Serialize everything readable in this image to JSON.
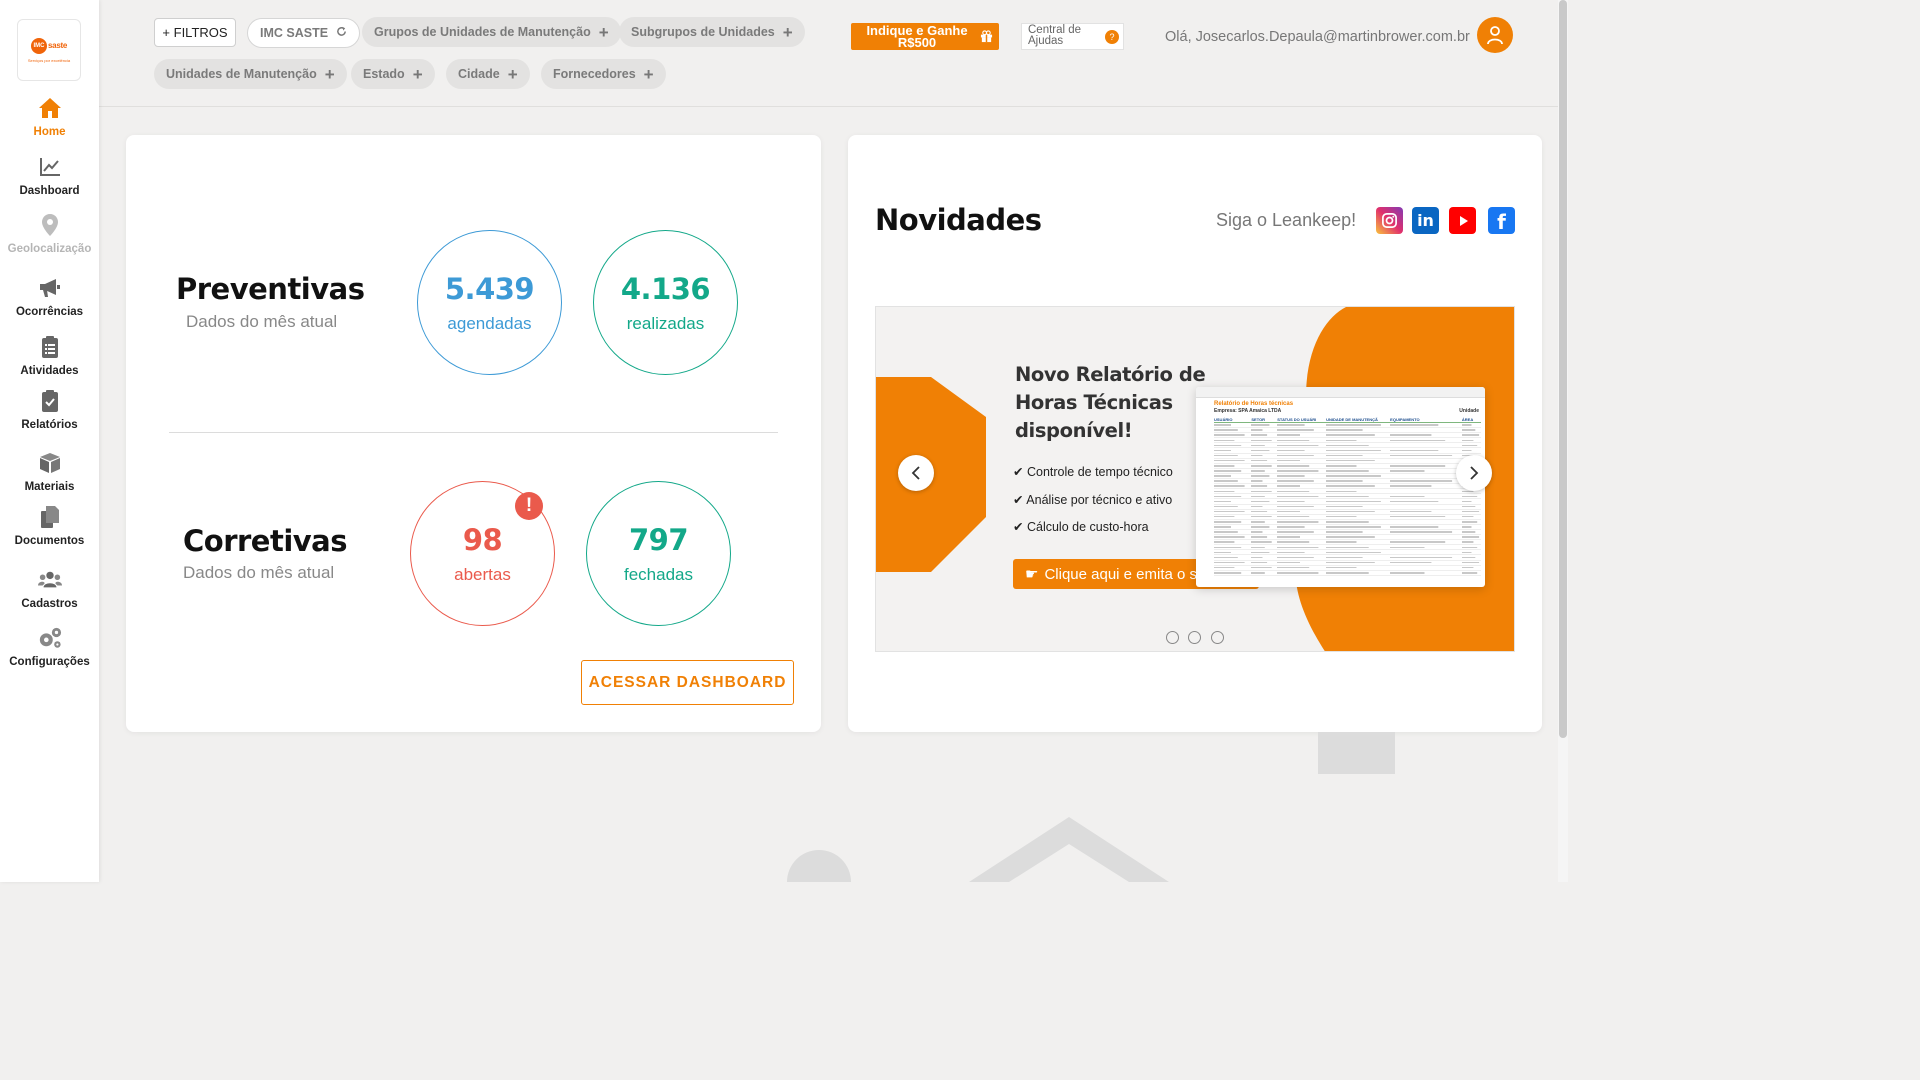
{
  "sidebar": {
    "logo": {
      "mark": "IMC",
      "word": "saste",
      "tagline": "Serviços por excelência"
    },
    "items": [
      {
        "label": "Home"
      },
      {
        "label": "Dashboard"
      },
      {
        "label": "Geolocalização"
      },
      {
        "label": "Ocorrências"
      },
      {
        "label": "Atividades"
      },
      {
        "label": "Relatórios"
      },
      {
        "label": "Materiais"
      },
      {
        "label": "Documentos"
      },
      {
        "label": "Cadastros"
      },
      {
        "label": "Configurações"
      }
    ]
  },
  "filters": {
    "button": "+ FILTROS",
    "chips": [
      {
        "label": "IMC SASTE"
      },
      {
        "label": "Grupos de Unidades de Manutenção"
      },
      {
        "label": "Subgrupos de Unidades"
      },
      {
        "label": "Unidades de Manutenção"
      },
      {
        "label": "Estado"
      },
      {
        "label": "Cidade"
      },
      {
        "label": "Fornecedores"
      }
    ]
  },
  "header": {
    "indique": "Indique e Ganhe R$500",
    "central": "Central de Ajudas",
    "greeting": "Olá, Josecarlos.Depaula@martinbrower.com.br"
  },
  "preventivas": {
    "title": "Preventivas",
    "subtitle": "Dados do mês atual",
    "agendadas_value": "5.439",
    "agendadas_label": "agendadas",
    "realizadas_value": "4.136",
    "realizadas_label": "realizadas"
  },
  "corretivas": {
    "title": "Corretivas",
    "subtitle": "Dados do mês atual",
    "abertas_value": "98",
    "abertas_label": "abertas",
    "fechadas_value": "797",
    "fechadas_label": "fechadas",
    "alert": "!"
  },
  "dashboard_button": "ACESSAR DASHBOARD",
  "novidades": {
    "title": "Novidades",
    "follow": "Siga o Leankeep!",
    "social": [
      "instagram",
      "linkedin",
      "youtube",
      "facebook"
    ],
    "banner": {
      "title": "Novo Relatório de Horas Técnicas disponível!",
      "bullets": [
        "Controle de tempo técnico",
        "Análise por técnico e ativo",
        "Cálculo de custo-hora"
      ],
      "cta": "Clique aqui e emita o seu!",
      "sheet_title": "Relatório de Horas técnicas",
      "sheet_company": "Empresa: SPA Amaica LTDA",
      "sheet_unit": "Unidade",
      "sheet_headers": [
        "USUÁRIO",
        "SETOR",
        "STATUS DO USUÁRI",
        "UNIDADE DE MANUTENÇÃ",
        "EQUIPAMENTO",
        "ÁREA"
      ]
    },
    "slides": 3,
    "active_slide": 0
  },
  "colors": {
    "accent": "#f08005",
    "blue": "#3d9ad6",
    "teal": "#13a889",
    "red": "#ea5a4c"
  }
}
